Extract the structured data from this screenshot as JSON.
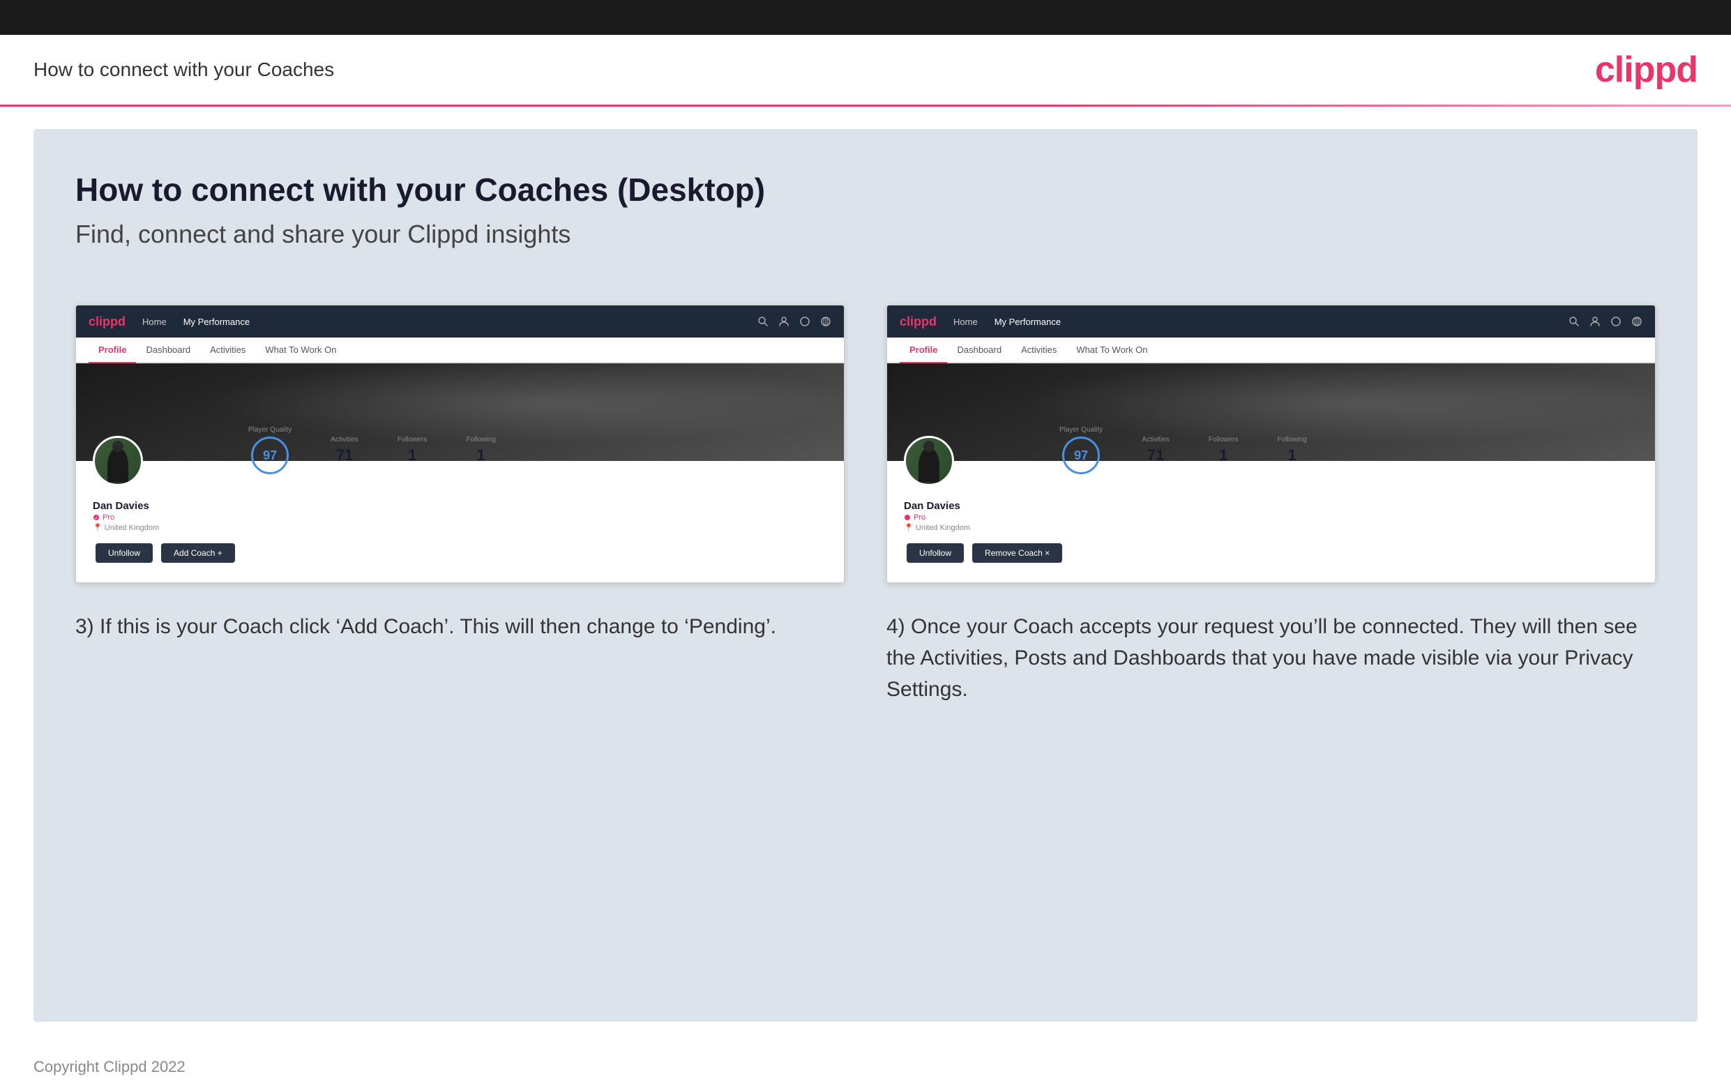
{
  "topBar": {},
  "header": {
    "title": "How to connect with your Coaches",
    "logo": "clippd"
  },
  "main": {
    "heading": "How to connect with your Coaches (Desktop)",
    "subheading": "Find, connect and share your Clippd insights",
    "col1": {
      "screenshot": {
        "nav": {
          "logo": "clippd",
          "links": [
            "Home",
            "My Performance"
          ]
        },
        "tabs": [
          "Profile",
          "Dashboard",
          "Activities",
          "What To Work On"
        ],
        "activeTab": "Profile",
        "profile": {
          "name": "Dan Davies",
          "badge": "Pro",
          "location": "United Kingdom",
          "playerQuality": "97",
          "stats": [
            {
              "label": "Player Quality",
              "value": "97",
              "type": "circle"
            },
            {
              "label": "Activities",
              "value": "71"
            },
            {
              "label": "Followers",
              "value": "1"
            },
            {
              "label": "Following",
              "value": "1"
            }
          ],
          "buttons": [
            "Unfollow",
            "Add Coach +"
          ]
        }
      },
      "description": "3) If this is your Coach click ‘Add Coach’. This will then change to ‘Pending’."
    },
    "col2": {
      "screenshot": {
        "nav": {
          "logo": "clippd",
          "links": [
            "Home",
            "My Performance"
          ]
        },
        "tabs": [
          "Profile",
          "Dashboard",
          "Activities",
          "What To Work On"
        ],
        "activeTab": "Profile",
        "profile": {
          "name": "Dan Davies",
          "badge": "Pro",
          "location": "United Kingdom",
          "playerQuality": "97",
          "stats": [
            {
              "label": "Player Quality",
              "value": "97",
              "type": "circle"
            },
            {
              "label": "Activities",
              "value": "71"
            },
            {
              "label": "Followers",
              "value": "1"
            },
            {
              "label": "Following",
              "value": "1"
            }
          ],
          "buttons": [
            "Unfollow",
            "Remove Coach ×"
          ]
        }
      },
      "description": "4) Once your Coach accepts your request you’ll be connected. They will then see the Activities, Posts and Dashboards that you have made visible via your Privacy Settings."
    }
  },
  "footer": {
    "copyright": "Copyright Clippd 2022"
  }
}
